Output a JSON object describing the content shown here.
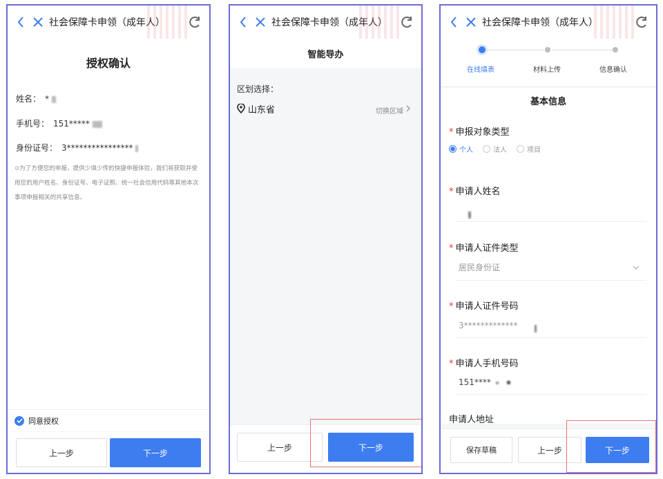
{
  "app_title": "社会保障卡申领（成年人）",
  "panel1": {
    "heading": "授权确认",
    "name_label": "姓名：",
    "name_value": "*",
    "phone_label": "手机号：",
    "phone_value": "151*****",
    "id_label": "身份证号：",
    "id_value": "3****************",
    "notice": "⊙为了方便您的申报，提供少填少传的快捷申报体验，我们将获取并使用您的用户姓名、身份证号、电子证照、统一社会信用代码等其他本次事项申报相关的共享信息。",
    "agree_label": "同意授权",
    "prev_label": "上一步",
    "next_label": "下一步"
  },
  "panel2": {
    "heading": "智能导办",
    "region_label": "区划选择：",
    "region_value": "山东省",
    "switch_label": "切换区域",
    "prev_label": "上一步",
    "next_label": "下一步"
  },
  "panel3": {
    "steps": [
      "在线填表",
      "材料上传",
      "信息确认"
    ],
    "section_title": "基本信息",
    "q_type": "申报对象类型",
    "type_options": [
      "个人",
      "法人",
      "项目"
    ],
    "q_name": "申请人姓名",
    "q_id_type": "申请人证件类型",
    "id_type_value": "居民身份证",
    "q_id_no": "申请人证件号码",
    "id_no_value": "3*************",
    "q_phone": "申请人手机号码",
    "phone_value": "151****",
    "q_address": "申请人地址",
    "save_label": "保存草稿",
    "prev_label": "上一步",
    "next_label": "下一步"
  },
  "colors": {
    "primary": "#3d7df0",
    "frame": "#6a6ad8",
    "required": "#e53935",
    "highlight": "#e57373"
  },
  "icons": {
    "back": "chevron-left-icon",
    "close": "close-icon",
    "refresh": "refresh-icon",
    "location": "location-pin-icon",
    "check": "check-circle-icon"
  }
}
